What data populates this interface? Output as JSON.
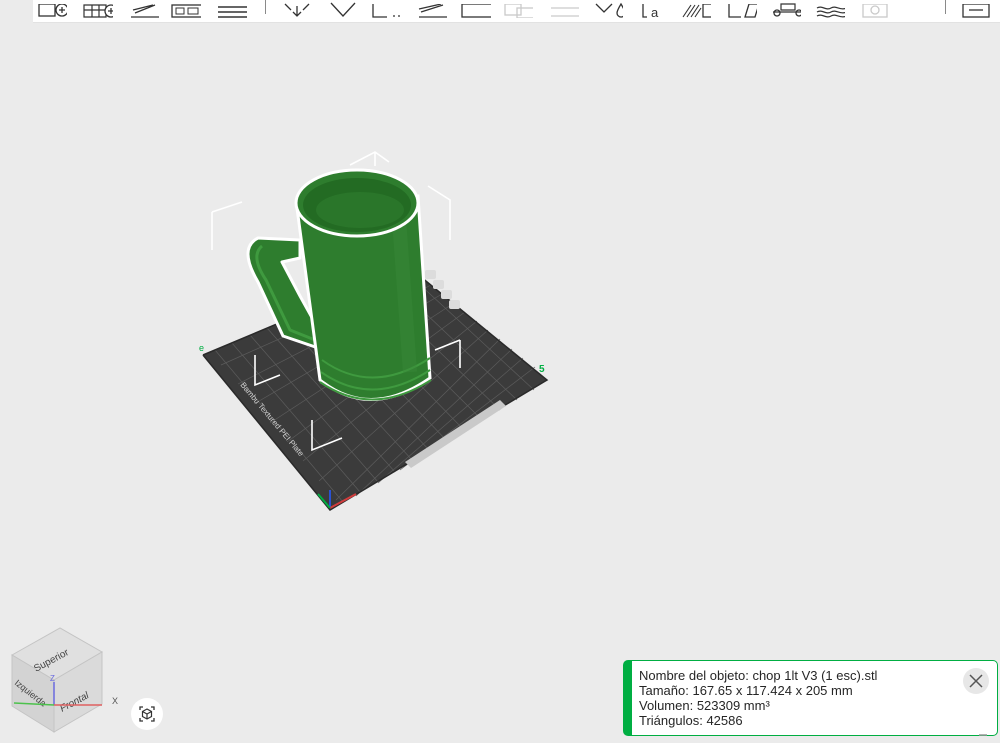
{
  "toolbar": {
    "buttons": [
      {
        "name": "add-object-icon"
      },
      {
        "name": "add-plate-icon"
      },
      {
        "name": "auto-orient-icon"
      },
      {
        "name": "arrange-icon"
      },
      {
        "name": "layers-icon"
      },
      {
        "name": "move-icon"
      },
      {
        "name": "rotate-icon"
      },
      {
        "name": "scale-icon"
      },
      {
        "name": "lay-on-face-icon"
      },
      {
        "name": "cut-icon"
      },
      {
        "name": "boolean-icon"
      },
      {
        "name": "split-icon"
      },
      {
        "name": "support-paint-icon"
      },
      {
        "name": "seam-paint-icon"
      },
      {
        "name": "text-icon"
      },
      {
        "name": "fuzzy-skin-icon"
      },
      {
        "name": "measure-icon"
      },
      {
        "name": "assembly-icon"
      },
      {
        "name": "variable-layer-icon"
      },
      {
        "name": "settings-icon"
      },
      {
        "name": "objects-list-icon"
      }
    ]
  },
  "plate": {
    "label": "Bambu Textured PEI Plate",
    "number": "5"
  },
  "view_cube": {
    "top": "Superior",
    "left": "Izquierda",
    "front": "Frontal",
    "axis_x": "X",
    "axis_z": "Z"
  },
  "info_panel": {
    "name_line": "Nombre del objeto: chop 1lt V3 (1 esc).stl",
    "size_line": "Tamaño: 167.65 x 117.424 x 205 mm",
    "volume_line": "Volumen: 523309 mm³",
    "triangles_line": " Triángulos: 42586"
  },
  "colors": {
    "accent": "#00ae42",
    "model": "#2e7d2e",
    "plate": "#3b3b3b",
    "background": "#ebebeb"
  }
}
